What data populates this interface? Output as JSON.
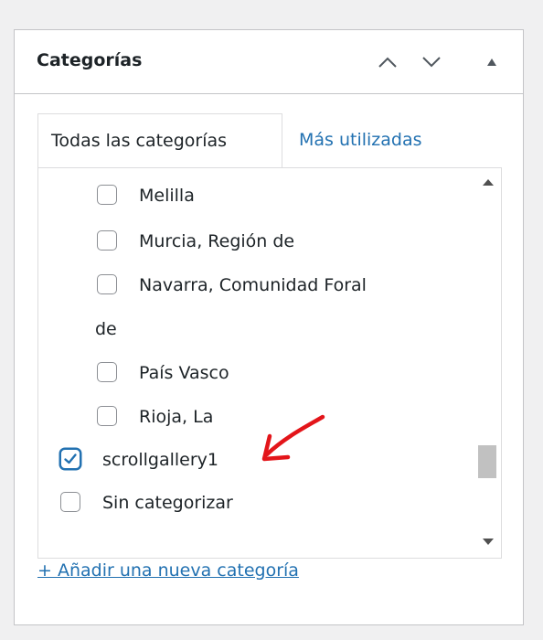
{
  "panel": {
    "title": "Categorías"
  },
  "tabs": {
    "all_label": "Todas las categorías",
    "most_used_label": "Más utilizadas"
  },
  "categories": [
    {
      "label": "Melilla",
      "checked": false
    },
    {
      "label": "Murcia, Región de",
      "checked": false
    },
    {
      "label_line1": "Navarra, Comunidad Foral",
      "label_line2": "de",
      "checked": false
    },
    {
      "label": "País Vasco",
      "checked": false
    },
    {
      "label": "Rioja, La",
      "checked": false
    },
    {
      "label": "scrollgallery1",
      "checked": true
    },
    {
      "label": "Sin categorizar",
      "checked": false
    }
  ],
  "add_link": "+ Añadir una nueva categoría",
  "colors": {
    "accent": "#2271b1",
    "annotation_arrow": "#e3151a"
  },
  "icons": {
    "move_up": "chevron-up-icon",
    "move_down": "chevron-down-icon",
    "collapse": "triangle-up-icon",
    "checked_mark": "checkmark-icon"
  }
}
